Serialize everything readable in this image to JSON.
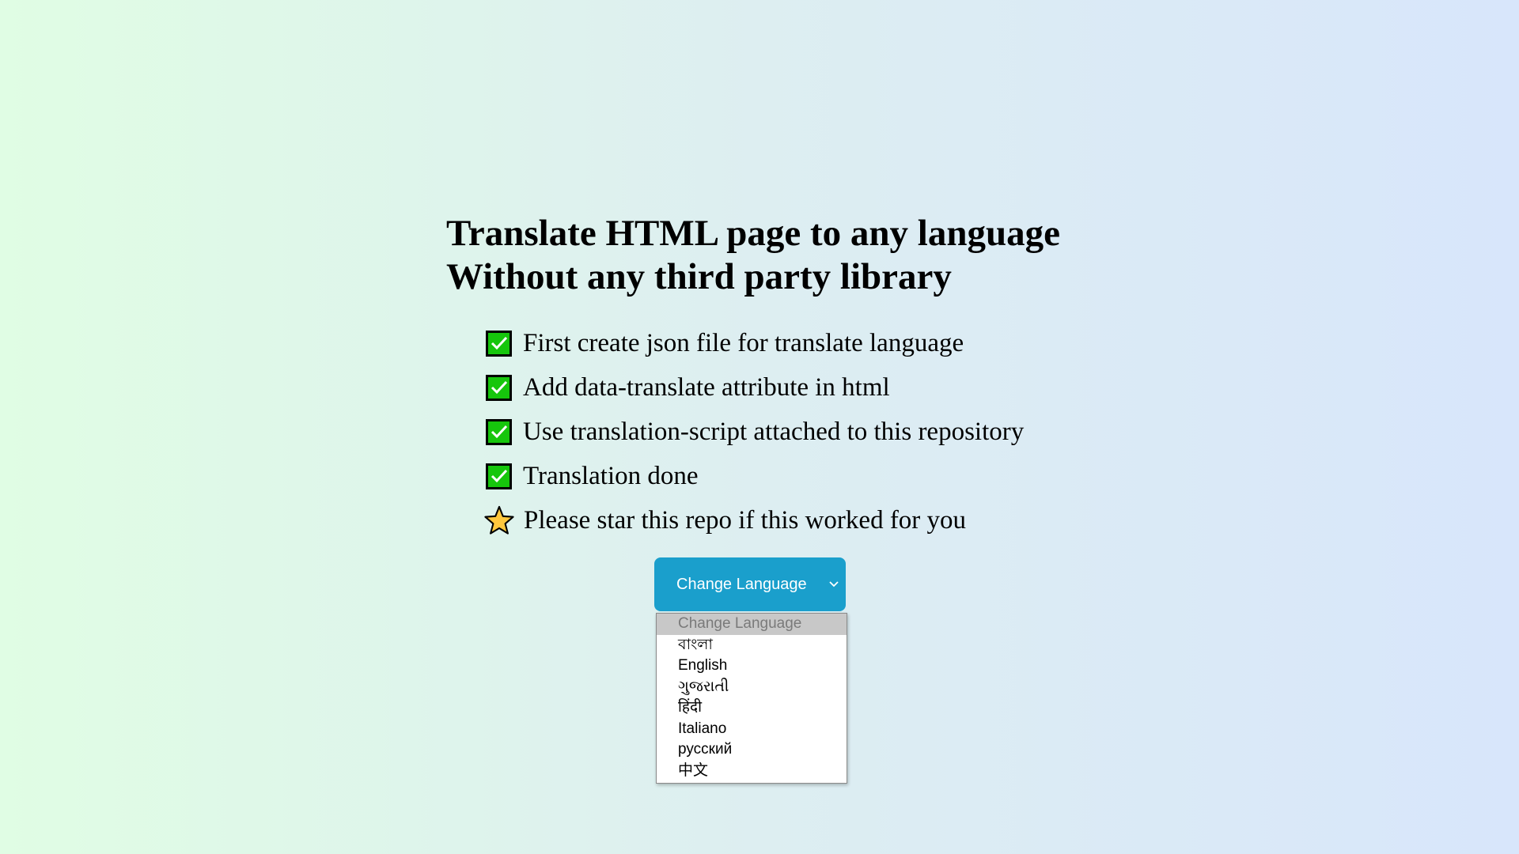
{
  "heading": {
    "line1": "Translate HTML page to any language",
    "line2": "Without any third party library"
  },
  "steps": [
    {
      "icon": "check-icon",
      "text": "First create json file for translate language"
    },
    {
      "icon": "check-icon",
      "text": "Add data-translate attribute in html"
    },
    {
      "icon": "check-icon",
      "text": "Use translation-script attached to this repository"
    },
    {
      "icon": "check-icon",
      "text": "Translation done"
    },
    {
      "icon": "star-icon",
      "text": "Please star this repo if this worked for you"
    }
  ],
  "language_select": {
    "label": "Change Language",
    "options": [
      "Change Language",
      "বাংলা",
      "English",
      "ગુજરાતી",
      "हिंदी",
      "Italiano",
      "русский",
      "中文"
    ]
  },
  "colors": {
    "check_green": "#16c60c",
    "button_blue": "#1a9fcc",
    "star_yellow": "#ffc83d"
  }
}
